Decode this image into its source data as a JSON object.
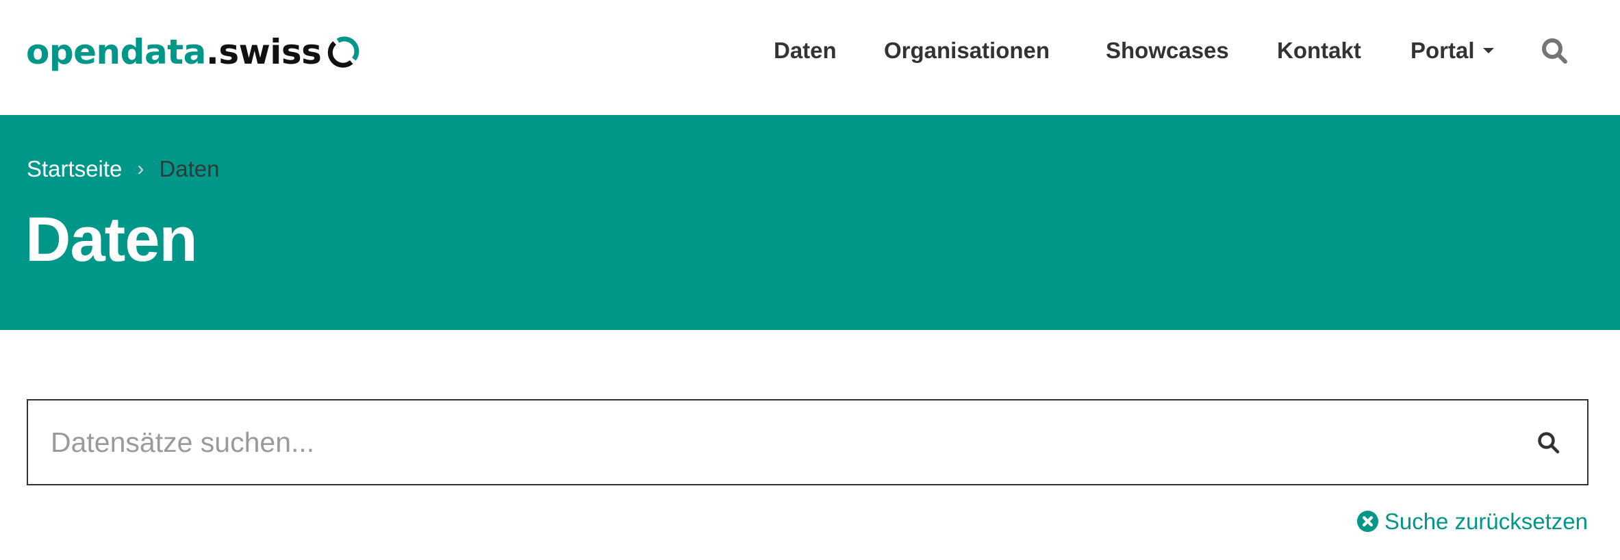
{
  "brand": {
    "name_part1": "opendata",
    "name_part2": ".swiss",
    "logo_icon": "ring-logo-icon",
    "colors": {
      "primary": "#009688",
      "dark": "#111111"
    }
  },
  "nav": {
    "items": [
      {
        "label": "Daten"
      },
      {
        "label": "Organisationen"
      },
      {
        "label": "Showcases"
      },
      {
        "label": "Kontakt"
      },
      {
        "label": "Portal",
        "has_dropdown": true,
        "icon": "caret-down-icon"
      }
    ],
    "search_icon": "search-icon"
  },
  "banner": {
    "background": "#009688",
    "breadcrumb": [
      {
        "label": "Startseite",
        "link": true
      },
      {
        "label": "Daten",
        "link": false
      }
    ],
    "breadcrumb_separator": "›",
    "title": "Daten"
  },
  "search": {
    "placeholder": "Datensätze suchen...",
    "value": "",
    "button_icon": "search-icon"
  },
  "reset": {
    "label": "Suche zurücksetzen",
    "icon": "times-circle-icon"
  }
}
